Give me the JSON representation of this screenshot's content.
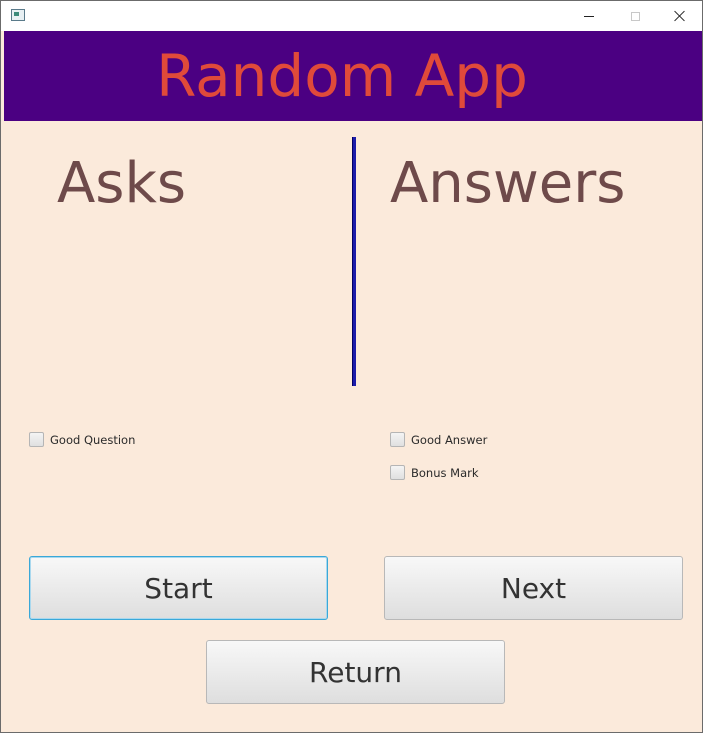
{
  "window": {
    "controls": {
      "minimize_icon": "minimize-icon",
      "maximize_icon": "maximize-icon",
      "close_icon": "close-icon"
    },
    "app_icon": "app-icon"
  },
  "header": {
    "title": "Random App",
    "background_color": "#4b0082",
    "title_color": "#e04a3a"
  },
  "columns": {
    "asks_title": "Asks",
    "answers_title": "Answers",
    "divider_color": "#1c1caa"
  },
  "checkboxes": {
    "good_question": {
      "label": "Good Question",
      "checked": false
    },
    "good_answer": {
      "label": "Good Answer",
      "checked": false
    },
    "bonus_mark": {
      "label": "Bonus Mark",
      "checked": false
    }
  },
  "buttons": {
    "start": "Start",
    "next": "Next",
    "return": "Return"
  },
  "colors": {
    "background": "#fbeadb",
    "heading_text": "#6e4a4a"
  }
}
